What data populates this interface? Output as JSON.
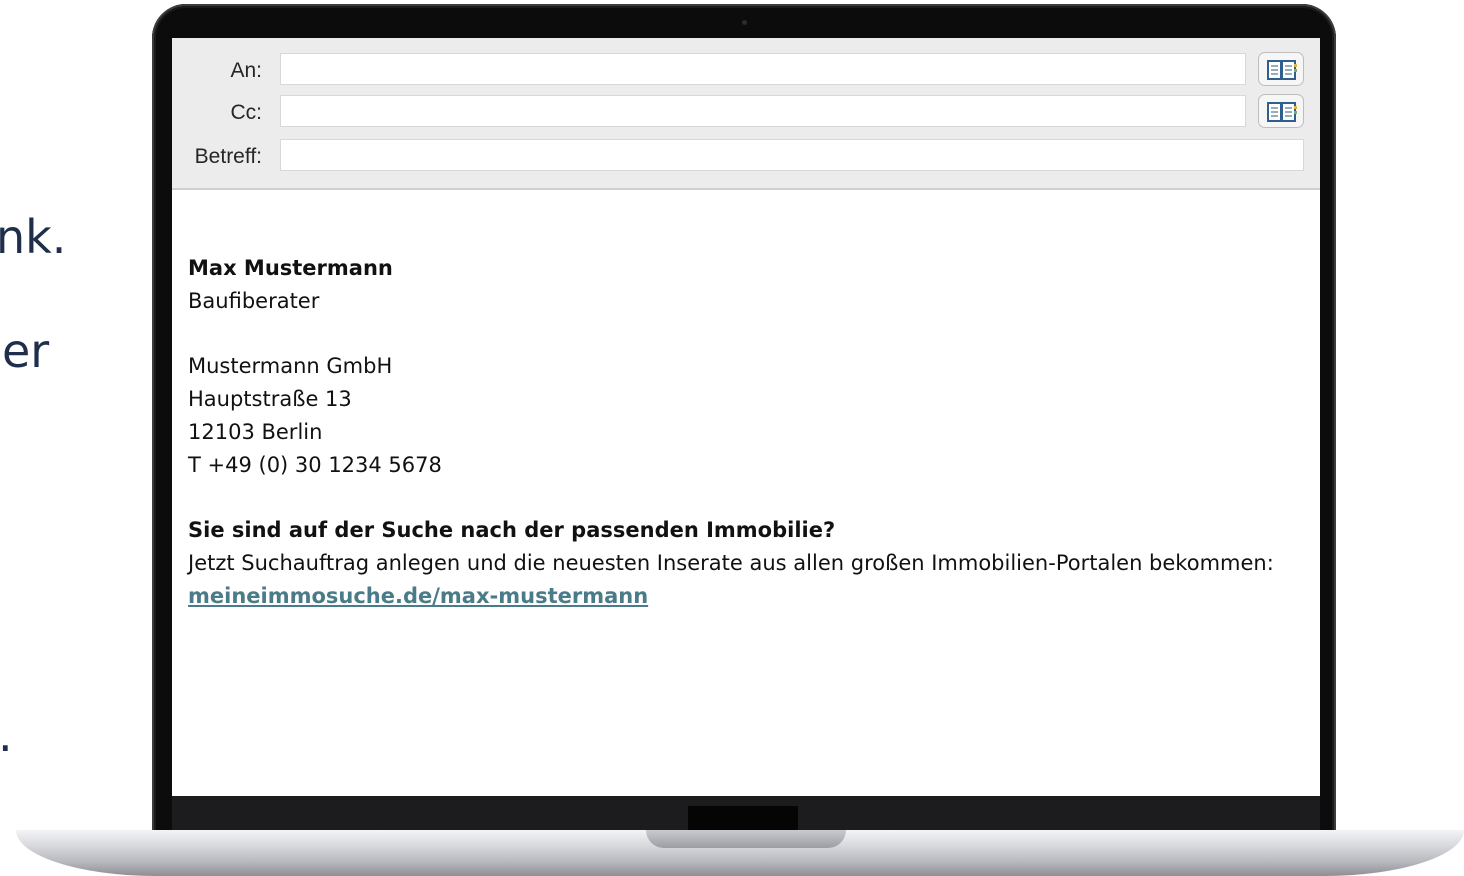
{
  "background_text": {
    "fragment1": "nk.",
    "fragment2": "er",
    "fragment3": "."
  },
  "mail": {
    "to_label": "An:",
    "cc_label": "Cc:",
    "subject_label": "Betreff:",
    "to_value": "",
    "cc_value": "",
    "subject_value": ""
  },
  "signature": {
    "name": "Max Mustermann",
    "role": "Baufiberater",
    "company": "Mustermann GmbH",
    "street": "Hauptstraße 13",
    "city": "12103 Berlin",
    "phone": "T +49 (0) 30 1234 5678",
    "promo_heading": "Sie sind auf der Suche nach der passenden Immobilie?",
    "promo_text": "Jetzt Suchauftrag anlegen und die neuesten Inserate aus allen großen Immobilien-Portalen bekommen:",
    "link": "meineimmosuche.de/max-mustermann"
  },
  "icons": {
    "to_address_book": "address-book-icon",
    "cc_address_book": "address-book-icon"
  },
  "colors": {
    "link": "#4a7b88",
    "background_text": "#1f2e4a"
  }
}
